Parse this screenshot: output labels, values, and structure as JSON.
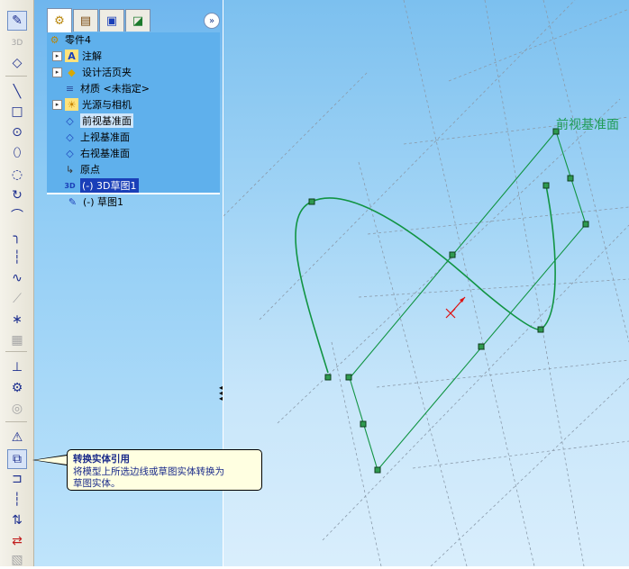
{
  "toolbar": {
    "items": [
      {
        "name": "sketch-button",
        "glyph": "✎",
        "active": true
      },
      {
        "name": "3d-sketch-button",
        "glyph": "3D",
        "dim": true
      },
      {
        "name": "smart-dimension-button",
        "glyph": "◇"
      },
      {
        "name": "line-button",
        "glyph": "╲"
      },
      {
        "name": "rectangle-button",
        "glyph": "□"
      },
      {
        "name": "circle-button",
        "glyph": "⊙"
      },
      {
        "name": "ellipse-button",
        "glyph": "⬯"
      },
      {
        "name": "centerpoint-arc-button",
        "glyph": "◌"
      },
      {
        "name": "tangent-arc-button",
        "glyph": "↻"
      },
      {
        "name": "three-point-arc-button",
        "glyph": "⌒"
      },
      {
        "name": "fillet-button",
        "glyph": "╮"
      },
      {
        "name": "centerline-button",
        "glyph": "┆"
      },
      {
        "name": "spline-button",
        "glyph": "∿"
      },
      {
        "name": "dim-tool-button",
        "glyph": "⟋",
        "dim": true
      },
      {
        "name": "point-button",
        "glyph": "∗"
      },
      {
        "name": "grid-button",
        "glyph": "▦",
        "dim": true
      },
      {
        "name": "add-relation-button",
        "glyph": "⊥"
      },
      {
        "name": "display-relations-button",
        "glyph": "⚙"
      },
      {
        "name": "offset-button",
        "glyph": "◎",
        "dim": true
      },
      {
        "name": "mirror-button",
        "glyph": "⚠"
      },
      {
        "name": "convert-entities-button",
        "glyph": "⧉",
        "active": true
      },
      {
        "name": "offset-entities-button",
        "glyph": "⊐"
      },
      {
        "name": "trim-button",
        "glyph": "┆"
      },
      {
        "name": "extend-button",
        "glyph": "⇅"
      },
      {
        "name": "move-button",
        "glyph": "⇄",
        "red": true
      },
      {
        "name": "rotate-button",
        "glyph": "▧",
        "dim": true
      }
    ]
  },
  "tabs": [
    {
      "name": "tab-feature-manager",
      "glyph": "⚙",
      "selected": true
    },
    {
      "name": "tab-property-manager",
      "glyph": "▤"
    },
    {
      "name": "tab-configuration-manager",
      "glyph": "▣"
    },
    {
      "name": "tab-display-manager",
      "glyph": "◪"
    }
  ],
  "tree": {
    "root": "零件4",
    "items": [
      {
        "name": "tree-item-annotations",
        "label": "注解",
        "expander": true,
        "icon": "A"
      },
      {
        "name": "tree-item-design-binder",
        "label": "设计活页夹",
        "expander": true,
        "icon": "◆"
      },
      {
        "name": "tree-item-material",
        "label": "材质 <未指定>",
        "expander": false,
        "icon": "≡"
      },
      {
        "name": "tree-item-lights-cameras",
        "label": "光源与相机",
        "expander": true,
        "icon": "☀"
      },
      {
        "name": "tree-item-front-plane",
        "label": "前视基准面",
        "expander": false,
        "icon": "◇",
        "highlight": true
      },
      {
        "name": "tree-item-top-plane",
        "label": "上视基准面",
        "expander": false,
        "icon": "◇"
      },
      {
        "name": "tree-item-right-plane",
        "label": "右视基准面",
        "expander": false,
        "icon": "◇"
      },
      {
        "name": "tree-item-origin",
        "label": "原点",
        "expander": false,
        "icon": "↳"
      },
      {
        "name": "tree-item-3d-sketch",
        "label": "(-) 3D草图1",
        "expander": false,
        "icon": "3D",
        "selected": true
      }
    ],
    "after_divider": {
      "name": "tree-item-sketch1",
      "label": "(-) 草图1",
      "icon": "✎"
    }
  },
  "viewport": {
    "plane_label": "前视基准面",
    "sketch_color": "#119443",
    "grid_color": "#8a9aaa"
  },
  "tooltip": {
    "title": "转换实体引用",
    "body_line1": "将模型上所选边线或草图实体转换为",
    "body_line2": "草图实体。"
  },
  "panel": {
    "expand_glyph": "»"
  }
}
